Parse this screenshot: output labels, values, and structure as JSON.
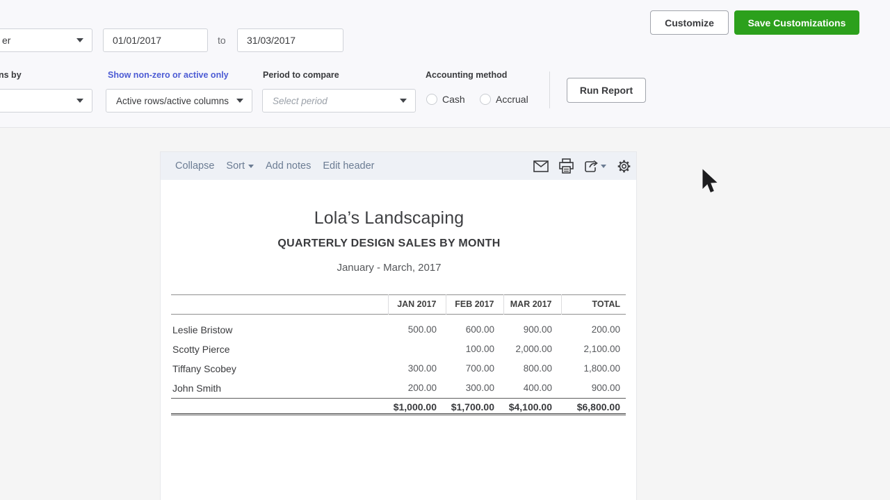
{
  "filters": {
    "report_range_dropdown_partial": "er",
    "date_from": "01/01/2017",
    "to_label": "to",
    "date_to": "31/03/2017",
    "customize_button": "Customize",
    "save_customizations_button": "Save Customizations",
    "columns_by_label_partial": "ns by",
    "show_nonzero_link": "Show non-zero or active only",
    "period_to_compare_label": "Period to compare",
    "accounting_method_label": "Accounting method",
    "active_rows_dropdown": "Active rows/active columns",
    "select_period_placeholder": "Select period",
    "cash_radio": "Cash",
    "accrual_radio": "Accrual",
    "run_report_button": "Run Report"
  },
  "toolbar": {
    "collapse": "Collapse",
    "sort": "Sort",
    "add_notes": "Add notes",
    "edit_header": "Edit header",
    "icons": [
      "mail-icon",
      "print-icon",
      "export-icon",
      "settings-icon"
    ]
  },
  "report": {
    "company": "Lola’s Landscaping",
    "title": "QUARTERLY DESIGN SALES BY MONTH",
    "period": "January - March, 2017"
  },
  "table": {
    "columns": [
      "",
      "JAN 2017",
      "FEB 2017",
      "MAR 2017",
      "TOTAL"
    ],
    "rows": [
      {
        "name": "Leslie Bristow",
        "values": [
          "500.00",
          "600.00",
          "900.00",
          "200.00"
        ]
      },
      {
        "name": "Scotty Pierce",
        "values": [
          "",
          "100.00",
          "2,000.00",
          "2,100.00"
        ]
      },
      {
        "name": "Tiffany Scobey",
        "values": [
          "300.00",
          "700.00",
          "800.00",
          "1,800.00"
        ]
      },
      {
        "name": "John Smith",
        "values": [
          "200.00",
          "300.00",
          "400.00",
          "900.00"
        ]
      }
    ],
    "total_row": [
      "$1,000.00",
      "$1,700.00",
      "$4,100.00",
      "$6,800.00"
    ]
  },
  "colors": {
    "accent_green": "#2ca01c",
    "link_blue": "#4c5bd4",
    "toolbar_link": "#6b7c93"
  }
}
